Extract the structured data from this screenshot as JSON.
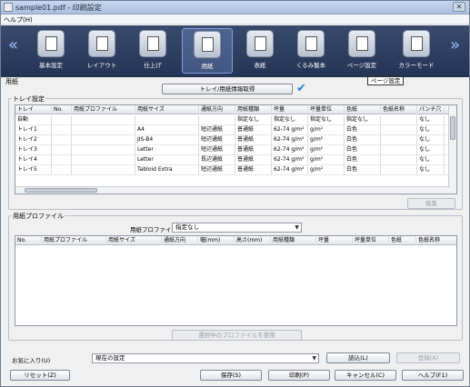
{
  "window": {
    "title": "sample01.pdf - 印刷設定",
    "close_glyph": "✕"
  },
  "menu": {
    "help": "ヘルプ(H)"
  },
  "toolbar": {
    "left_arrow": "«",
    "right_arrow": "»",
    "items": [
      {
        "label": "基本設定"
      },
      {
        "label": "レイアウト"
      },
      {
        "label": "仕上げ"
      },
      {
        "label": "用紙",
        "active": true
      },
      {
        "label": "表紙"
      },
      {
        "label": "くるみ製本"
      },
      {
        "label": "ページ設定"
      },
      {
        "label": "カラーモード"
      }
    ]
  },
  "tooltip": "ページ設定",
  "paper": {
    "group_label": "用紙",
    "fetch_button": "トレイ/用紙情報取得",
    "tray_group_label": "トレイ設定",
    "tray_columns": [
      "トレイ",
      "No.",
      "用紙プロファイル",
      "用紙サイズ",
      "通紙方向",
      "用紙種類",
      "坪量",
      "坪量単位",
      "色紙",
      "色紙名称",
      "パンチ穴"
    ],
    "tray_rows": [
      [
        "自動",
        "",
        "",
        "",
        "",
        "指定なし",
        "指定なし",
        "指定なし",
        "指定なし",
        "",
        "なし"
      ],
      [
        "トレイ1",
        "",
        "",
        "A4",
        "短辺通紙",
        "普通紙",
        "62-74 g/m²",
        "g/m²",
        "白色",
        "",
        "なし"
      ],
      [
        "トレイ2",
        "",
        "",
        "JIS-B4",
        "短辺通紙",
        "普通紙",
        "62-74 g/m²",
        "g/m²",
        "白色",
        "",
        "なし"
      ],
      [
        "トレイ3",
        "",
        "",
        "Letter",
        "短辺通紙",
        "普通紙",
        "62-74 g/m²",
        "g/m²",
        "白色",
        "",
        "なし"
      ],
      [
        "トレイ4",
        "",
        "",
        "Letter",
        "長辺通紙",
        "普通紙",
        "62-74 g/m²",
        "g/m²",
        "白色",
        "",
        "なし"
      ],
      [
        "トレイ5",
        "",
        "",
        "Tabloid Extra",
        "短辺通紙",
        "普通紙",
        "62-74 g/m²",
        "g/m²",
        "白色",
        "",
        "なし"
      ]
    ],
    "edit_button": "編集"
  },
  "profile": {
    "group_label": "用紙プロファイル",
    "filter_label": "用紙プロファイル",
    "filter_value": "指定なし",
    "columns": [
      "No.",
      "用紙プロファイル",
      "用紙サイズ",
      "通紙方向",
      "幅(mm)",
      "高さ(mm)",
      "用紙種類",
      "坪量",
      "坪量単位",
      "色紙",
      "色紙名称"
    ],
    "use_button": "選択中のプロファイルを使用"
  },
  "favorites": {
    "label": "お気に入り(U)",
    "value": "現在の設定",
    "load_button": "読込(L)",
    "register_button": "登録(A)"
  },
  "footer": {
    "reset": "リセット(Z)",
    "save": "保存(S)",
    "print": "印刷(P)",
    "cancel": "キャンセル(C)",
    "help": "ヘルプ(F1)"
  }
}
